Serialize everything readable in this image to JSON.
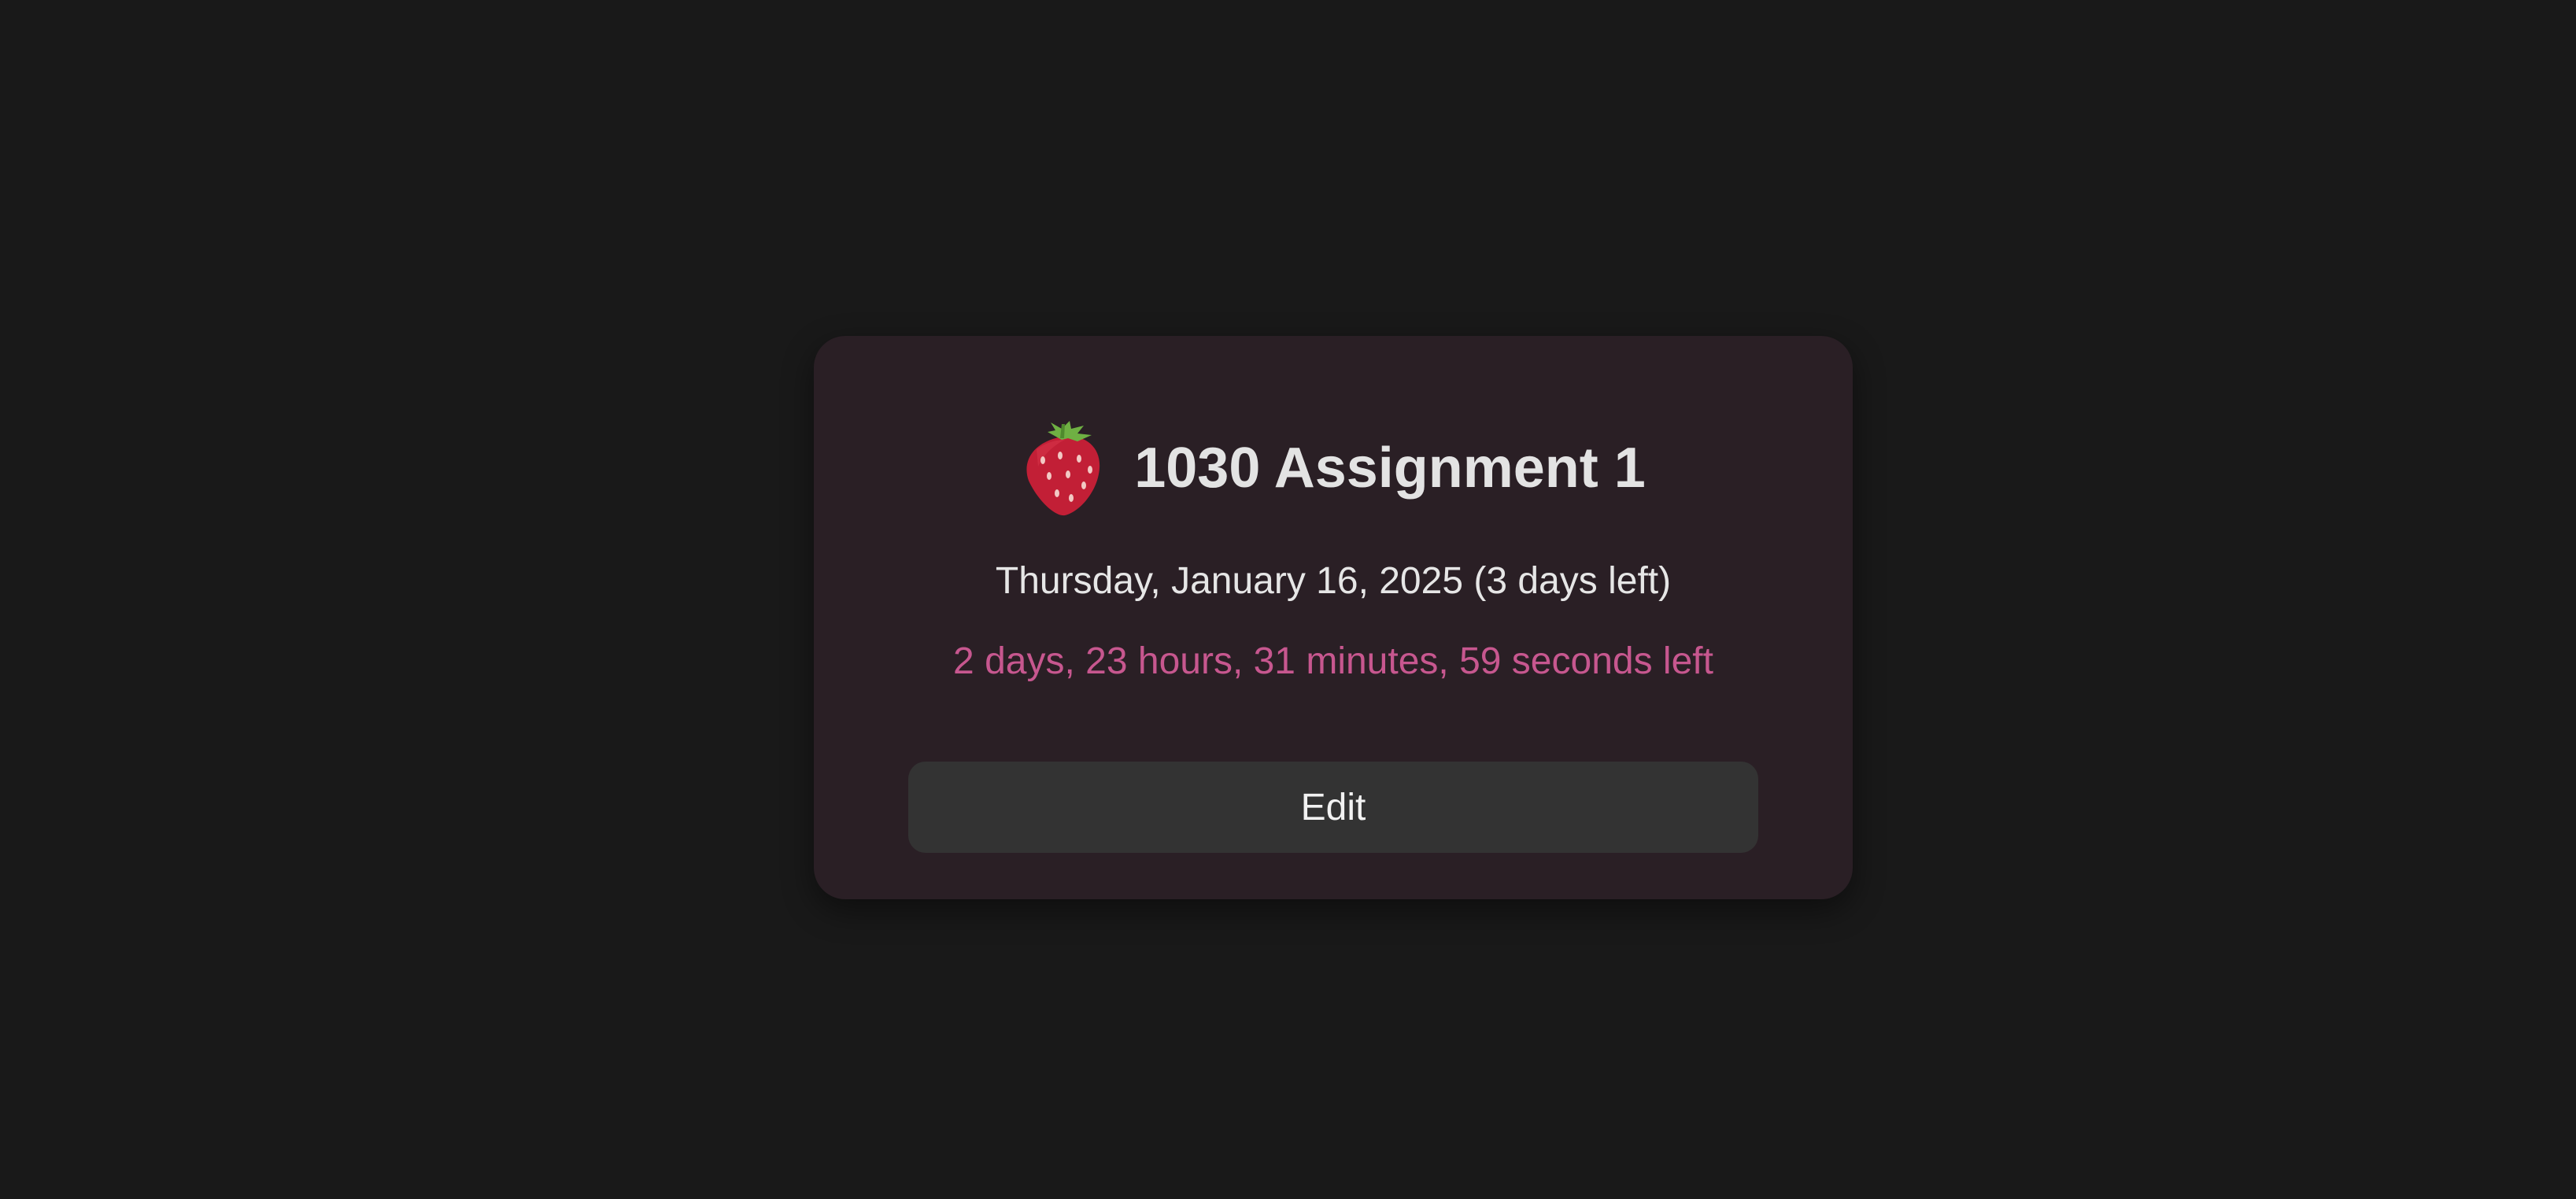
{
  "assignment": {
    "icon": "strawberry-icon",
    "title": "1030 Assignment 1",
    "due_date_text": "Thursday, January 16, 2025 (3 days left)",
    "countdown_text": "2 days, 23 hours, 31 minutes, 59 seconds left",
    "edit_label": "Edit"
  },
  "colors": {
    "background": "#191919",
    "card": "#2a1f25",
    "countdown_accent": "#c7578f",
    "button": "#333333"
  }
}
